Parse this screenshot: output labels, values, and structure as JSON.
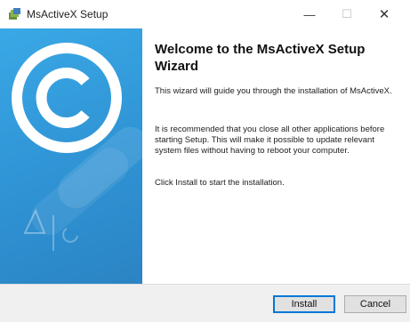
{
  "window": {
    "title": "MsActiveX Setup",
    "controls": {
      "minimize": "—",
      "maximize": "☐",
      "close": "✕"
    },
    "icon": "installer-icon"
  },
  "sidebar": {
    "graphic": "copyright-logo-graphic",
    "accent_color": "#3aa8e6"
  },
  "content": {
    "title": "Welcome to the MsActiveX Setup Wizard",
    "p1": "This wizard will guide you through the installation of MsActiveX.",
    "p2": "It is recommended that you close all other applications before starting Setup. This will make it possible to update relevant system files without having to reboot your computer.",
    "p3": "Click Install to start the installation."
  },
  "buttons": {
    "install": "Install",
    "cancel": "Cancel"
  }
}
